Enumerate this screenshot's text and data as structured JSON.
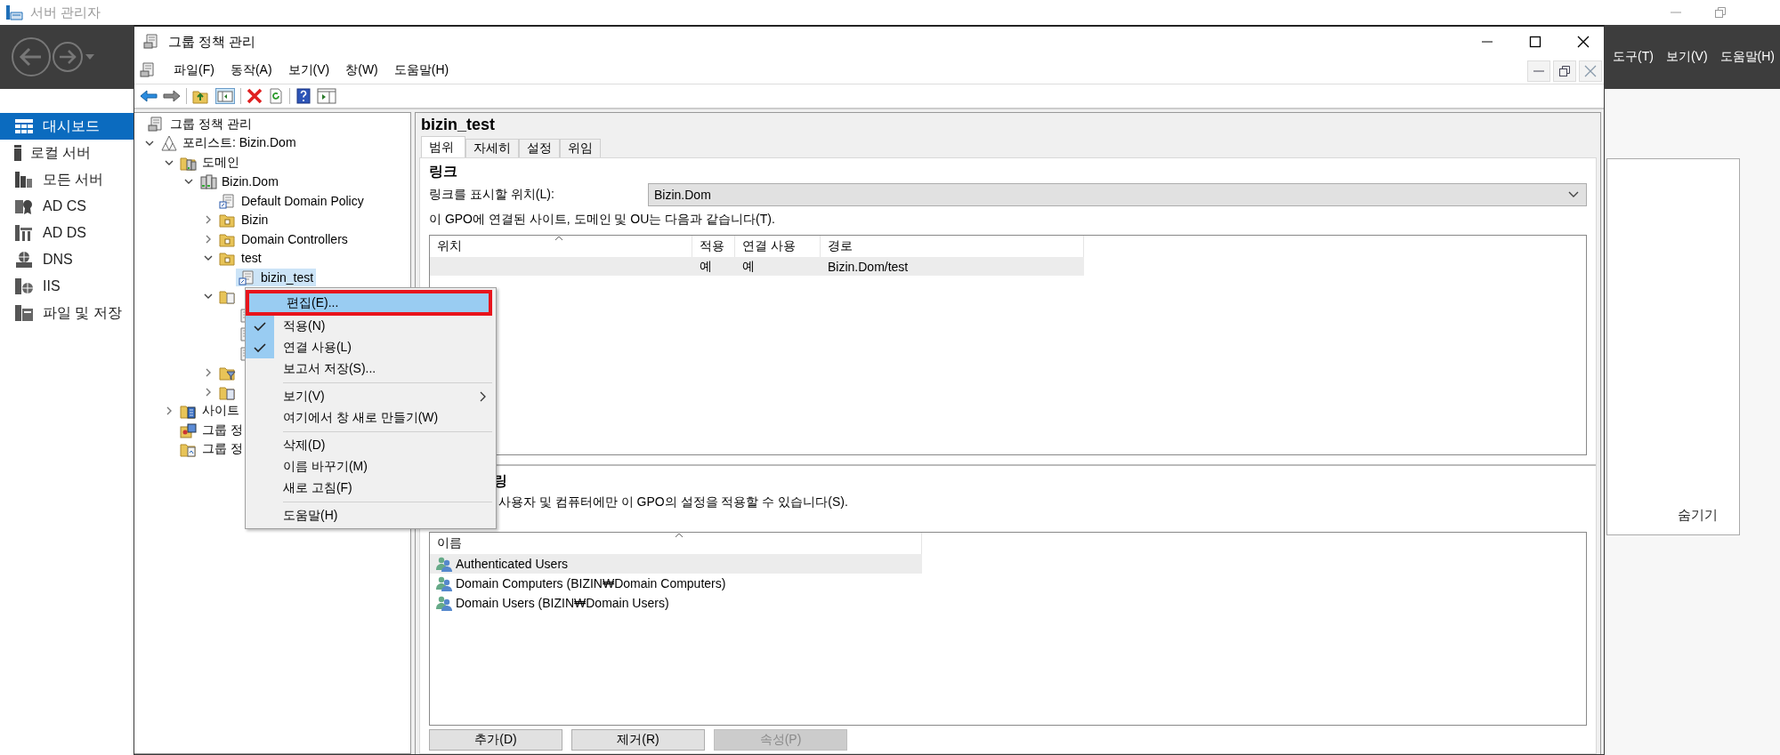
{
  "server_manager": {
    "title": "서버 관리자",
    "menu": [
      "도구(T)",
      "보기(V)",
      "도움말(H)"
    ],
    "sidebar": [
      {
        "label": "대시보드",
        "selected": true
      },
      {
        "label": "로컬 서버",
        "selected": false
      },
      {
        "label": "모든 서버",
        "selected": false
      },
      {
        "label": "AD CS",
        "selected": false
      },
      {
        "label": "AD DS",
        "selected": false
      },
      {
        "label": "DNS",
        "selected": false
      },
      {
        "label": "IIS",
        "selected": false
      },
      {
        "label": "파일 및 저장",
        "selected": false
      }
    ],
    "panel": {
      "hide_link": "숨기기"
    }
  },
  "gpmc": {
    "title": "그룹 정책 관리",
    "menu": [
      "파일(F)",
      "동작(A)",
      "보기(V)",
      "창(W)",
      "도움말(H)"
    ],
    "tree": [
      {
        "kind": "root",
        "label": "그룹 정책 관리",
        "selected": false,
        "children": [
          {
            "kind": "forest",
            "label": "포리스트: Bizin.Dom",
            "selected": false,
            "expanded": true,
            "children": [
              {
                "kind": "domains",
                "label": "도메인",
                "selected": false,
                "expanded": true,
                "children": [
                  {
                    "kind": "domain",
                    "label": "Bizin.Dom",
                    "selected": false,
                    "expanded": true,
                    "children": [
                      {
                        "kind": "gpo-link",
                        "label": "Default Domain Policy",
                        "selected": false
                      },
                      {
                        "kind": "ou",
                        "label": "Bizin",
                        "selected": false,
                        "expanded": false
                      },
                      {
                        "kind": "ou",
                        "label": "Domain Controllers",
                        "selected": false,
                        "expanded": false
                      },
                      {
                        "kind": "ou",
                        "label": "test",
                        "selected": false,
                        "expanded": true,
                        "children": [
                          {
                            "kind": "gpo-link",
                            "label": "bizin_test",
                            "selected": true
                          }
                        ]
                      },
                      {
                        "kind": "gpo-folder",
                        "selected": false,
                        "expanded": true,
                        "children": [
                          {
                            "kind": "gpo",
                            "selected": false
                          },
                          {
                            "kind": "gpo",
                            "selected": false
                          },
                          {
                            "kind": "gpo",
                            "selected": false
                          }
                        ]
                      },
                      {
                        "kind": "wmi-folder",
                        "selected": false,
                        "expanded": false
                      },
                      {
                        "kind": "starter-folder",
                        "selected": false,
                        "expanded": false
                      }
                    ]
                  }
                ]
              },
              {
                "kind": "sites",
                "label": "사이트",
                "selected": false,
                "expanded": false
              },
              {
                "kind": "modeling",
                "label": "그룹 정",
                "selected": false
              },
              {
                "kind": "results",
                "label": "그룹 정",
                "selected": false
              }
            ]
          }
        ]
      }
    ],
    "detail": {
      "title": "bizin_test",
      "tabs": [
        {
          "label": "범위",
          "selected": true
        },
        {
          "label": "자세히",
          "selected": false
        },
        {
          "label": "설정",
          "selected": false
        },
        {
          "label": "위임",
          "selected": false
        }
      ],
      "links_heading": "링크",
      "location_label": "링크를 표시할 위치(L):",
      "location_value": "Bizin.Dom",
      "links_note": "이 GPO에 연결된 사이트, 도메인 및 OU는 다음과 같습니다(T).",
      "links_table": {
        "columns": [
          "위치",
          "적용",
          "연결 사용",
          "경로"
        ],
        "rows": [
          {
            "selected": true,
            "applied": "예",
            "link_enabled": "예",
            "path": "Bizin.Dom/test"
          }
        ]
      },
      "filter_heading": "링",
      "filter_note": "사용자 및 컴퓨터에만 이 GPO의 설정을 적용할 수 있습니다(S).",
      "filter_table": {
        "column": "이름",
        "rows": [
          {
            "name": "Authenticated Users",
            "selected": true
          },
          {
            "name": "Domain Computers (BIZIN₩Domain Computers)",
            "selected": false
          },
          {
            "name": "Domain Users (BIZIN₩Domain Users)",
            "selected": false
          }
        ]
      },
      "buttons": [
        {
          "label": "추가(D)",
          "disabled": false
        },
        {
          "label": "제거(R)",
          "disabled": false
        },
        {
          "label": "속성(P)",
          "disabled": true
        }
      ]
    }
  },
  "context_menu": {
    "groups": [
      [
        {
          "label": "편집(E)...",
          "selected": true,
          "annotated": true,
          "checked": false,
          "submenu": false
        },
        {
          "label": "적용(N)",
          "selected": false,
          "annotated": false,
          "checked": true,
          "submenu": false
        },
        {
          "label": "연결 사용(L)",
          "selected": false,
          "annotated": false,
          "checked": true,
          "submenu": false
        },
        {
          "label": "보고서 저장(S)...",
          "selected": false,
          "annotated": false,
          "checked": false,
          "submenu": false
        }
      ],
      [
        {
          "label": "보기(V)",
          "selected": false,
          "annotated": false,
          "checked": false,
          "submenu": true
        },
        {
          "label": "여기에서 창 새로 만들기(W)",
          "selected": false,
          "annotated": false,
          "checked": false,
          "submenu": false
        }
      ],
      [
        {
          "label": "삭제(D)",
          "selected": false,
          "annotated": false,
          "checked": false,
          "submenu": false
        },
        {
          "label": "이름 바꾸기(M)",
          "selected": false,
          "annotated": false,
          "checked": false,
          "submenu": false
        },
        {
          "label": "새로 고침(F)",
          "selected": false,
          "annotated": false,
          "checked": false,
          "submenu": false
        }
      ],
      [
        {
          "label": "도움말(H)",
          "selected": false,
          "annotated": false,
          "checked": false,
          "submenu": false
        }
      ]
    ]
  }
}
